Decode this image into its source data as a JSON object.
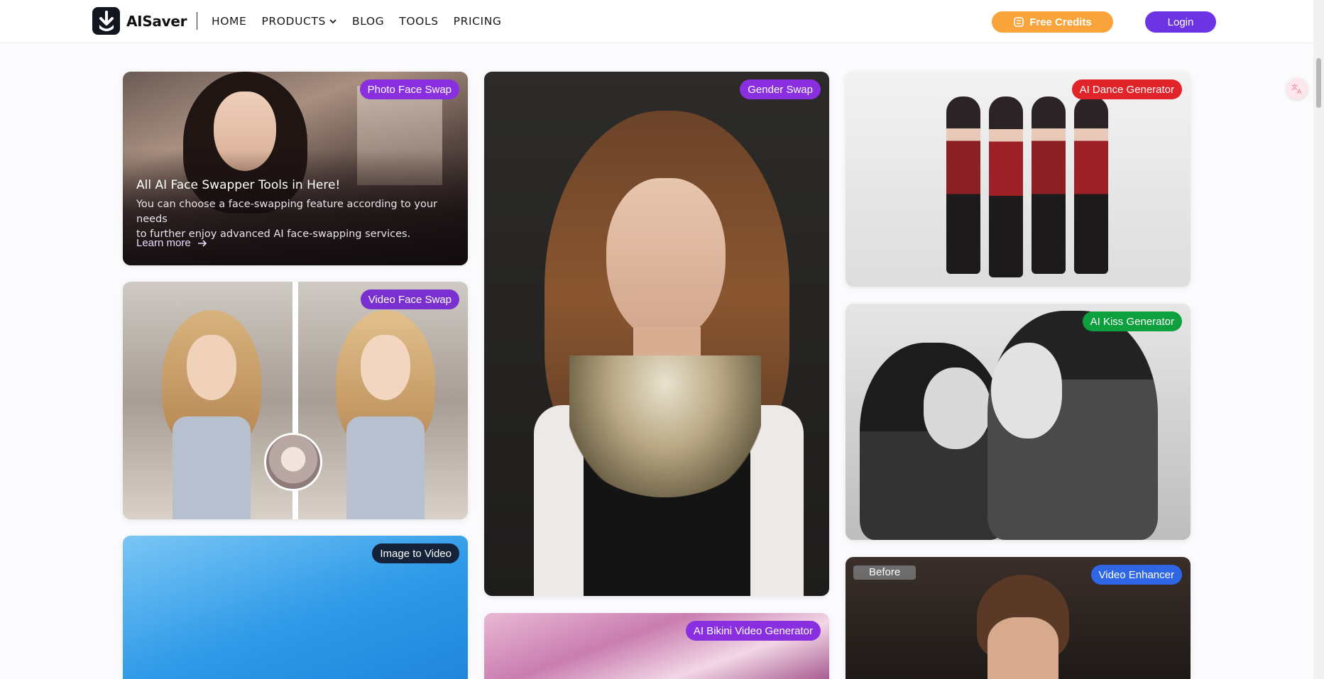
{
  "header": {
    "logo_text": "AISaver",
    "nav": [
      {
        "label": "HOME"
      },
      {
        "label": "PRODUCTS"
      },
      {
        "label": "BLOG"
      },
      {
        "label": "TOOLS"
      },
      {
        "label": "PRICING"
      }
    ],
    "free_credits_label": "Free Credits",
    "login_label": "Login"
  },
  "cards": {
    "photo_face_swap": {
      "tag": "Photo Face Swap",
      "title": "All AI Face Swapper Tools in Here!",
      "desc_line1": "You can choose a face-swapping feature according to your needs",
      "desc_line2": "to further enjoy advanced AI face-swapping services.",
      "link": "Learn more"
    },
    "video_face_swap": {
      "tag": "Video Face Swap"
    },
    "image_to_video": {
      "tag": "Image to Video"
    },
    "gender_swap": {
      "tag": "Gender Swap"
    },
    "ai_bikini_video_generator": {
      "tag": "AI Bikini Video Generator"
    },
    "ai_dance_generator": {
      "tag": "AI Dance Generator"
    },
    "ai_kiss_generator": {
      "tag": "AI Kiss Generator"
    },
    "video_enhancer": {
      "tag": "Video Enhancer",
      "before_label": "Before"
    }
  },
  "colors": {
    "brand_purple": "#6d34e3",
    "credits_orange": "#f9a43b",
    "tag_purple": "#8a2fe0",
    "tag_red": "#e0242a",
    "tag_green": "#0e9f3e",
    "tag_blue": "#2f66e6",
    "tag_dark": "#14233a"
  },
  "icons": [
    "logo-download-icon",
    "chevron-down-icon",
    "coin-icon",
    "arrow-right-icon",
    "translate-icon"
  ]
}
